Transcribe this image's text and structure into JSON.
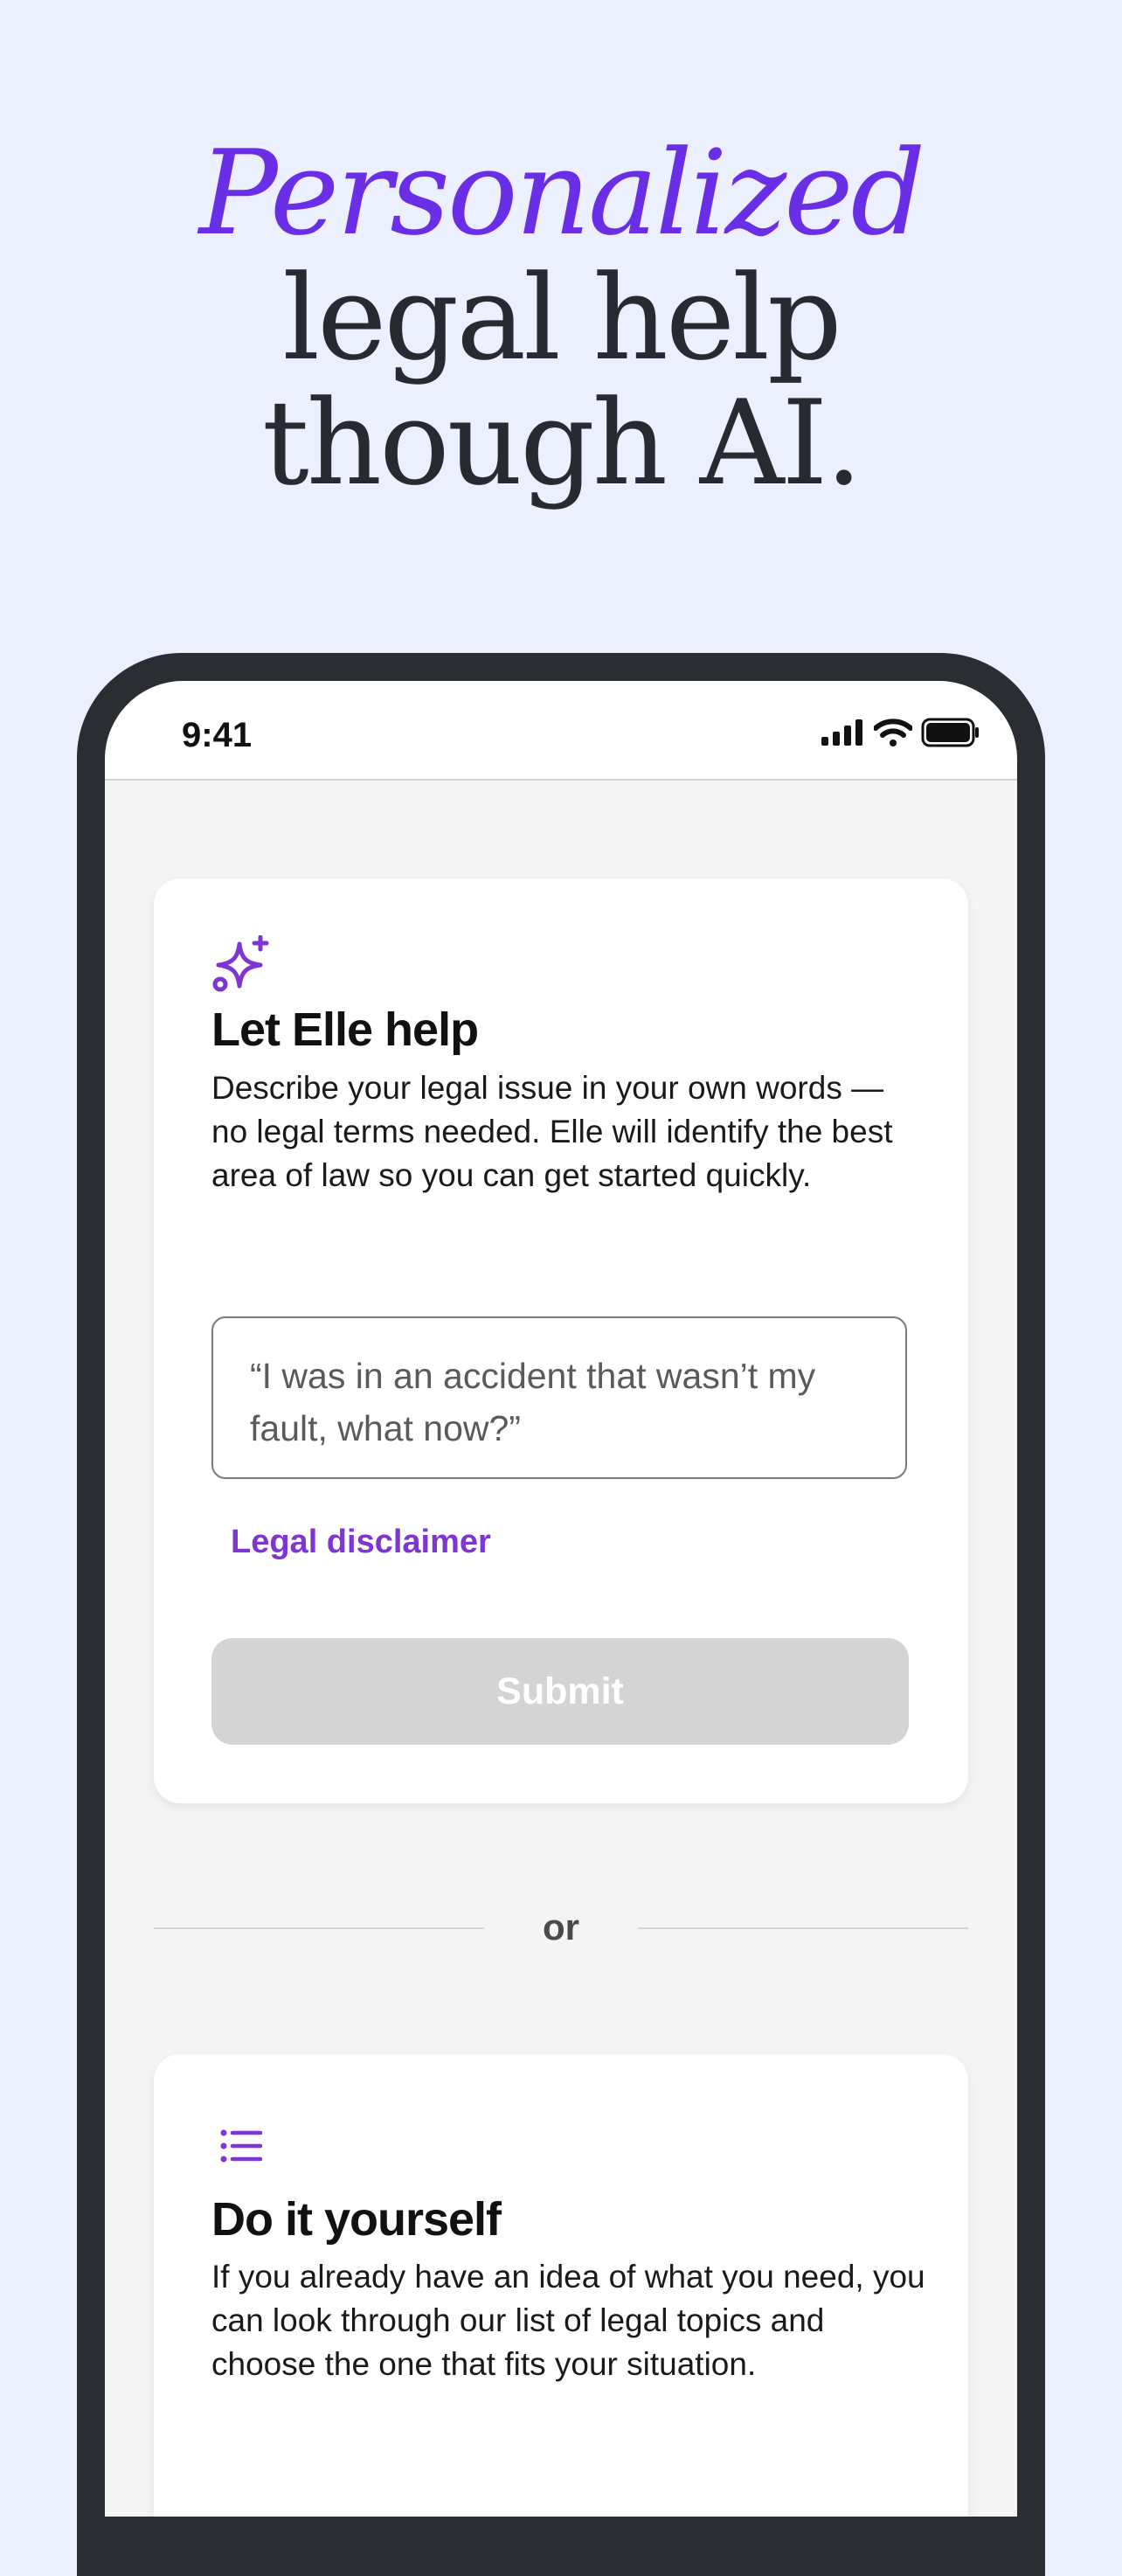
{
  "headline": {
    "accent": "Personalized",
    "line1": "legal help",
    "line2": "though AI."
  },
  "status_bar": {
    "time": "9:41",
    "icons": [
      "cellular-signal-icon",
      "wifi-icon",
      "battery-icon"
    ]
  },
  "elle_card": {
    "icon": "sparkles-icon",
    "title": "Let Elle help",
    "description": "Describe your legal issue in your own words — no legal terms needed. Elle will identify the best area of law so you can get started quickly.",
    "input_placeholder": "“I was in an accident that wasn’t my fault, what now?”",
    "disclaimer_link": "Legal disclaimer",
    "submit_label": "Submit"
  },
  "divider": {
    "label": "or"
  },
  "diy_card": {
    "icon": "list-icon",
    "title": "Do it yourself",
    "description": "If you already have an idea of what you need, you can look through our list of legal topics and choose the one that fits your situation."
  },
  "colors": {
    "background": "#ebeffe",
    "accent": "#6a2ee6",
    "link": "#7e36d3",
    "submit_disabled": "#d4d4d4",
    "phone_frame": "#2a2d32"
  }
}
